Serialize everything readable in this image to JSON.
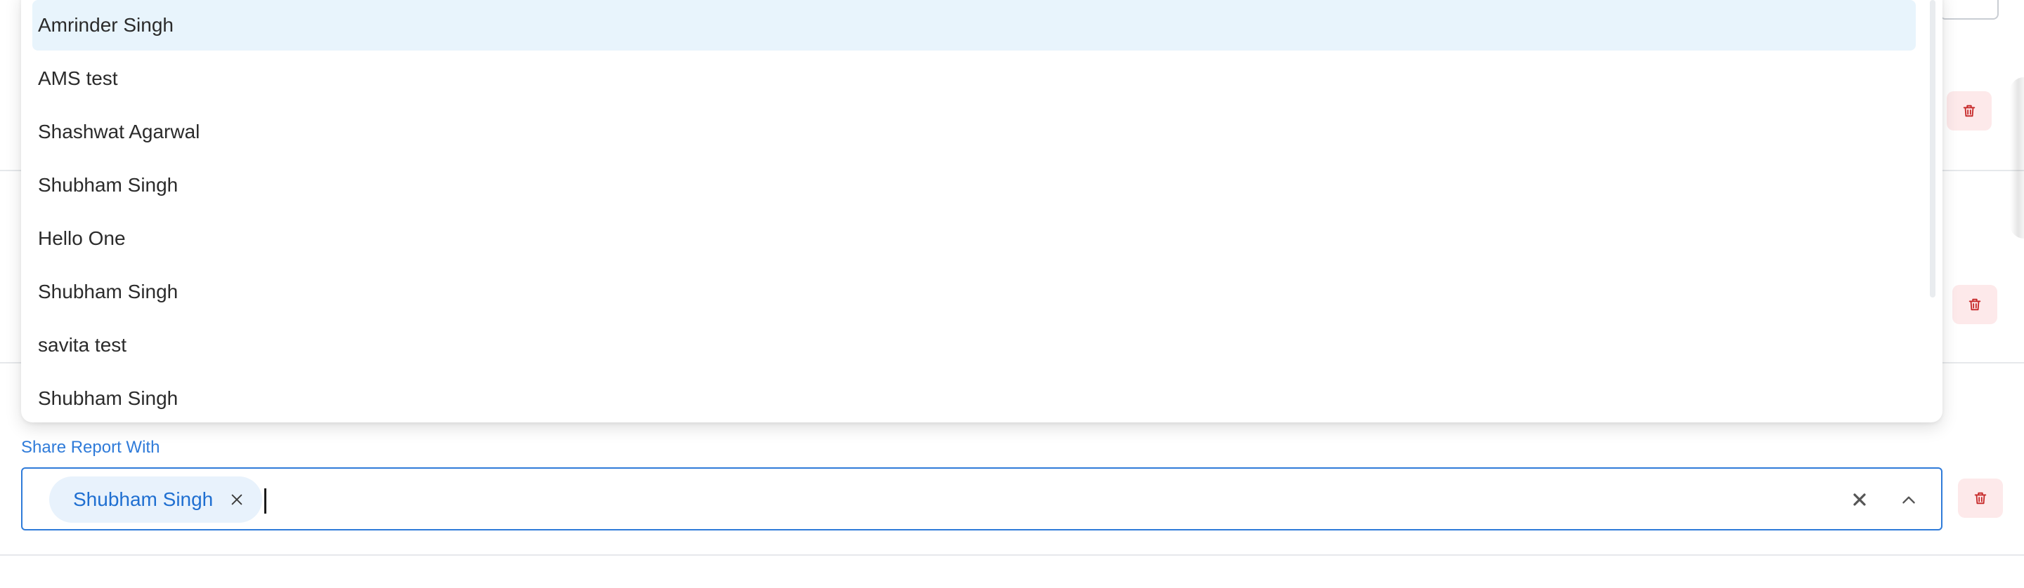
{
  "dropdown": {
    "options": [
      {
        "label": "Amrinder Singh",
        "highlighted": true
      },
      {
        "label": "AMS test",
        "highlighted": false
      },
      {
        "label": "Shashwat Agarwal",
        "highlighted": false
      },
      {
        "label": "Shubham Singh",
        "highlighted": false
      },
      {
        "label": "Hello One",
        "highlighted": false
      },
      {
        "label": "Shubham Singh",
        "highlighted": false
      },
      {
        "label": "savita test",
        "highlighted": false
      },
      {
        "label": "Shubham Singh",
        "highlighted": false
      }
    ]
  },
  "share_field": {
    "label": "Share Report With",
    "selected_chips": [
      {
        "label": "Shubham Singh"
      }
    ],
    "input_value": ""
  },
  "icons": {
    "delete": "trash-icon",
    "chip_remove": "close-icon",
    "clear": "close-icon",
    "toggle": "chevron-up-icon"
  },
  "colors": {
    "accent": "#2f7bd9",
    "highlight": "#e8f4fc",
    "chip_bg": "#e8f2fc",
    "delete_bg": "#fde9ea",
    "delete_icon": "#c62828"
  }
}
